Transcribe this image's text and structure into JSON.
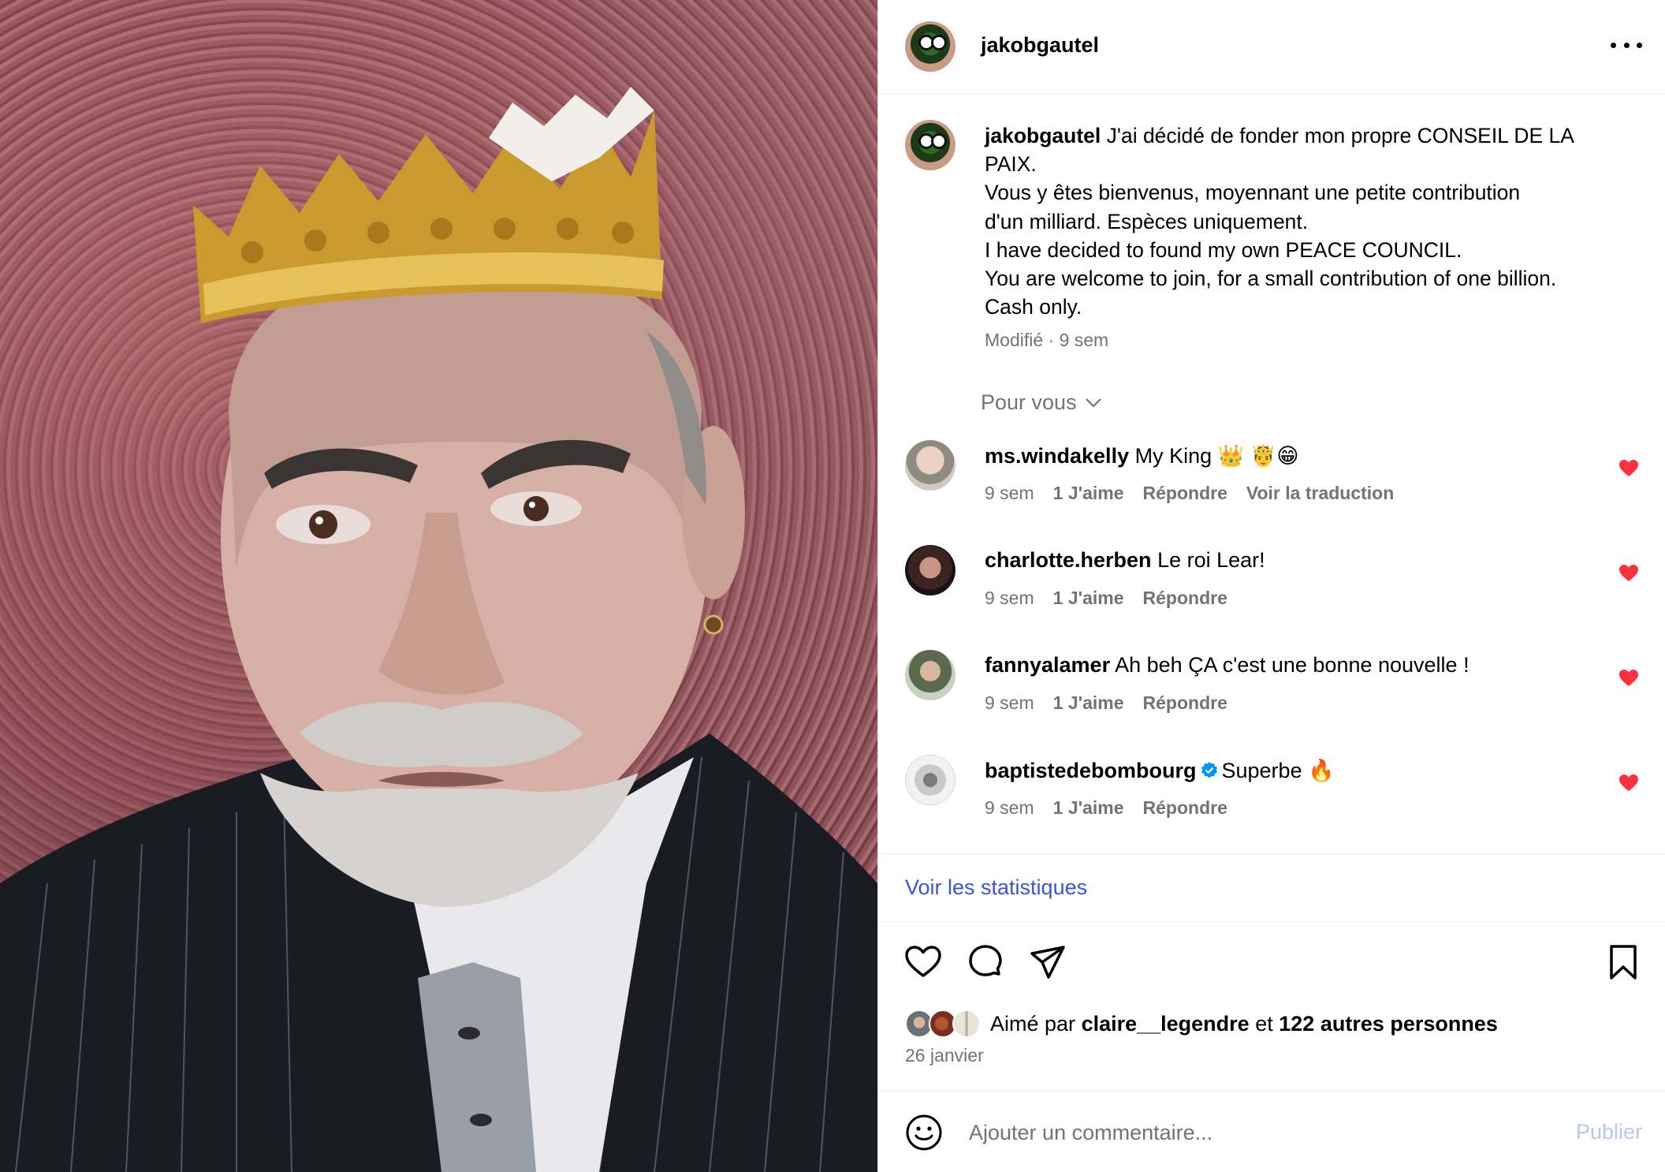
{
  "post": {
    "author": "jakobgautel",
    "caption_lines": [
      "J'ai décidé de fonder mon propre CONSEIL DE LA",
      "PAIX.",
      "Vous y êtes bienvenus, moyennant une petite contribution",
      "d'un milliard. Espèces uniquement.",
      "I have decided to found my own PEACE COUNCIL.",
      "You are welcome to join, for a small contribution of one billion.",
      "Cash only."
    ],
    "caption_meta": "Modifié · 9 sem",
    "sort_label": "Pour vous"
  },
  "comments": [
    {
      "user": "ms.windakelly",
      "text": "My King 👑 🤴😁",
      "time": "9 sem",
      "likes": "1 J'aime",
      "reply": "Répondre",
      "translate": "Voir la traduction",
      "verified": false
    },
    {
      "user": "charlotte.herben",
      "text": "Le roi Lear!",
      "time": "9 sem",
      "likes": "1 J'aime",
      "reply": "Répondre",
      "verified": false
    },
    {
      "user": "fannyalamer",
      "text": "Ah beh ÇA c'est une bonne nouvelle !",
      "time": "9 sem",
      "likes": "1 J'aime",
      "reply": "Répondre",
      "verified": false
    },
    {
      "user": "baptistedebombourg",
      "text": "Superbe 🔥",
      "time": "9 sem",
      "likes": "1 J'aime",
      "reply": "Répondre",
      "verified": true
    }
  ],
  "stats_link": "Voir les statistiques",
  "likes": {
    "prefix": "Aimé par",
    "user": "claire__legendre",
    "connector": "et",
    "others": "122 autres personnes"
  },
  "date": "26 janvier",
  "composer": {
    "placeholder": "Ajouter un commentaire...",
    "publish": "Publier"
  },
  "colors": {
    "heart": "#ff3040",
    "link": "#3b55d8",
    "muted": "#737373",
    "publish_disabled": "#b2c9f5"
  }
}
